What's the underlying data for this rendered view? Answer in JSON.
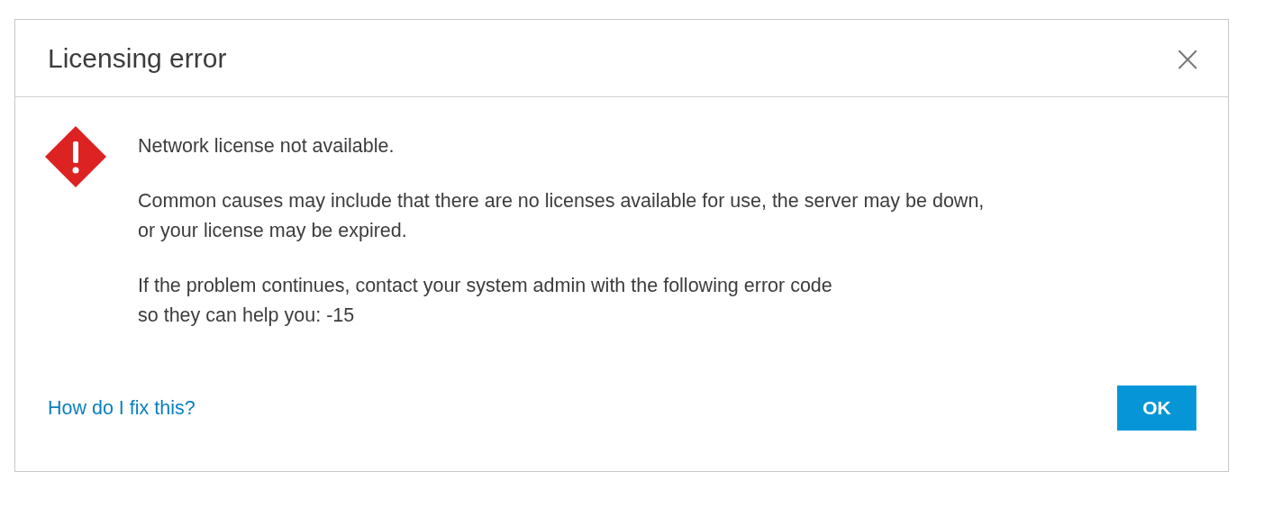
{
  "dialog": {
    "title": "Licensing error",
    "close": "×",
    "icon": {
      "kind": "error"
    },
    "paragraphs": [
      [
        "Network license not available."
      ],
      [
        "Common causes may include that there are no licenses available for use, the server may be down,",
        "or your license may be expired."
      ],
      [
        "If the problem continues, contact your system admin with the following error code",
        "so they can help you: -15"
      ]
    ],
    "help_link": "How do I fix this?",
    "buttons": [
      {
        "label": "OK",
        "primary": true
      }
    ]
  }
}
